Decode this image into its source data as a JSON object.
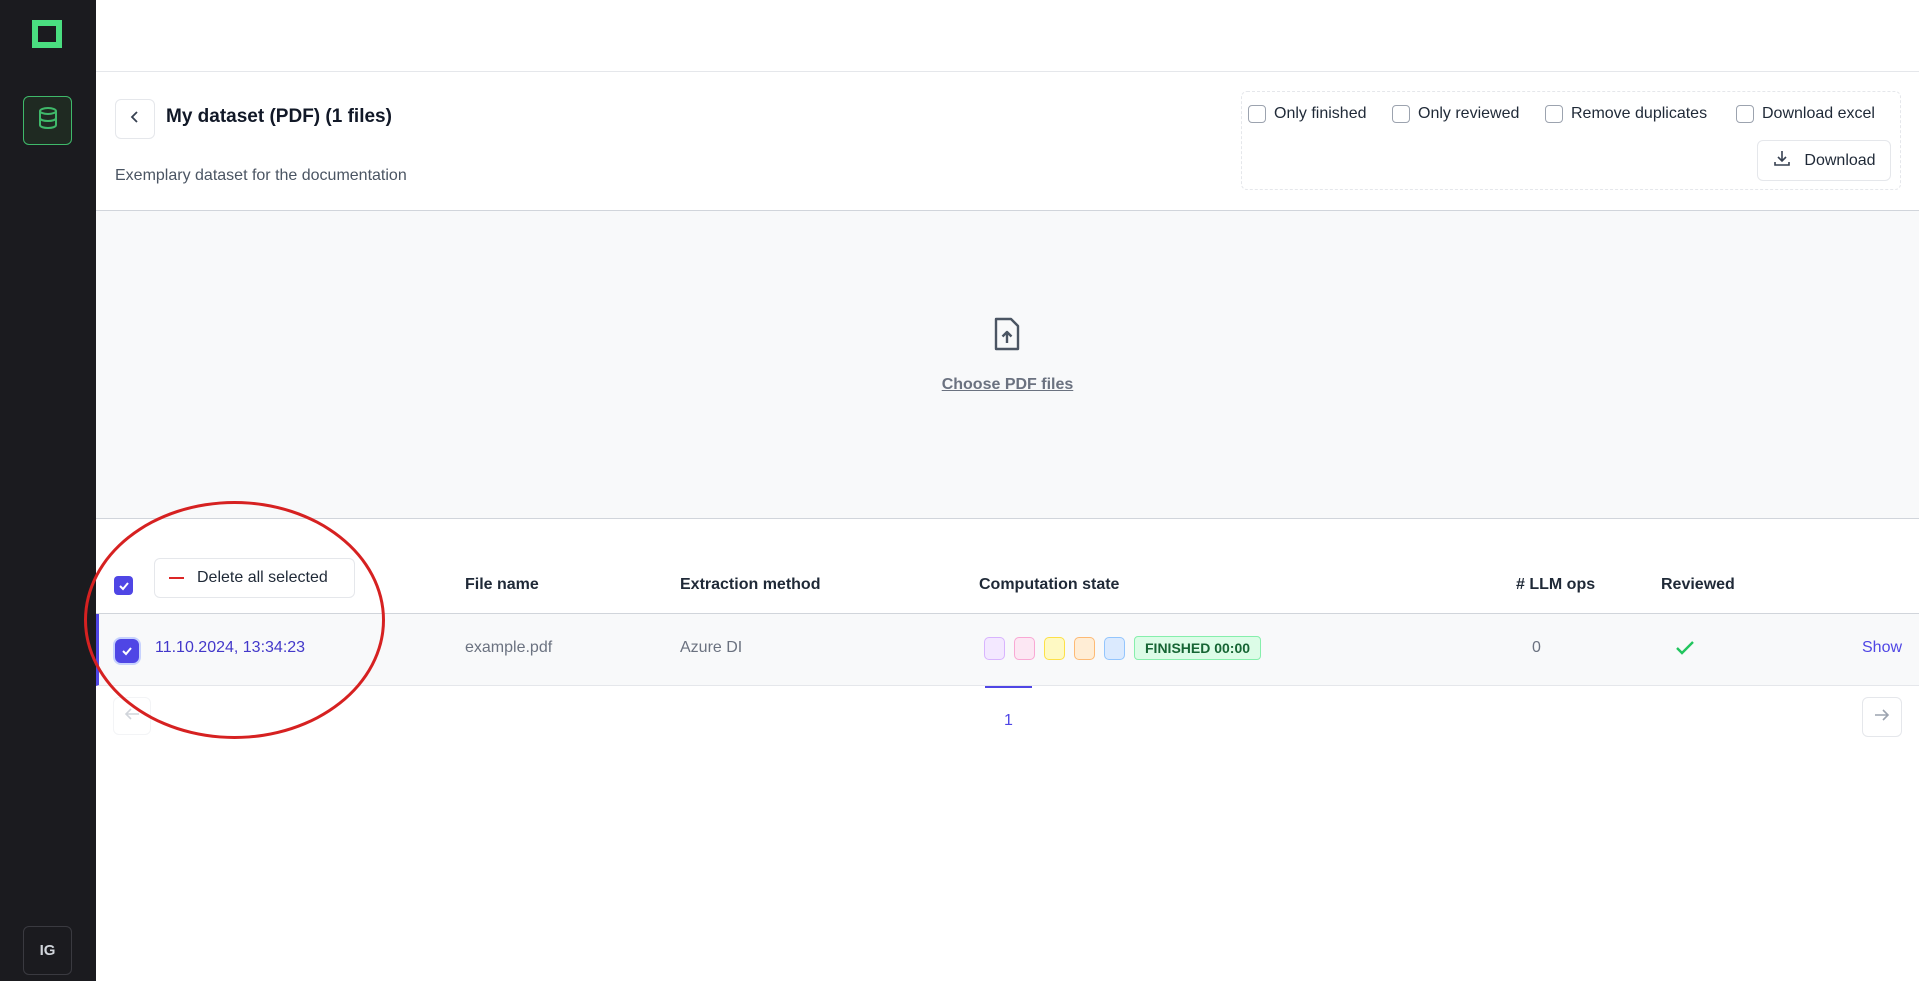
{
  "sidebar": {
    "avatar_initials": "IG",
    "icons": {
      "logo": "app-logo-icon",
      "nav": "database-icon"
    },
    "colors": {
      "background": "#1b1b1f",
      "accent": "#3fb96a"
    }
  },
  "header": {
    "title": "My dataset (PDF) (1 files)",
    "subtitle": "Exemplary dataset for the documentation",
    "options": [
      {
        "label": "Only finished",
        "checked": false
      },
      {
        "label": "Only reviewed",
        "checked": false
      },
      {
        "label": "Remove duplicates",
        "checked": false
      },
      {
        "label": "Download excel",
        "checked": false
      }
    ],
    "download_label": "Download"
  },
  "upload": {
    "link_label": "Choose PDF files"
  },
  "table": {
    "delete_label": "Delete all selected",
    "columns": [
      "File name",
      "Extraction method",
      "Computation state",
      "# LLM ops",
      "Reviewed"
    ],
    "rows": [
      {
        "created": "11.10.2024, 13:34:23",
        "file_name": "example.pdf",
        "extraction_method": "Azure DI",
        "status": "FINISHED 00:00",
        "llm_ops": "0",
        "reviewed": true,
        "action": "Show",
        "selected": true
      }
    ]
  },
  "pagination": {
    "current_page": "1"
  },
  "colors": {
    "primary": "#4f46e5",
    "success": "#22c55e",
    "danger": "#dc2626"
  }
}
